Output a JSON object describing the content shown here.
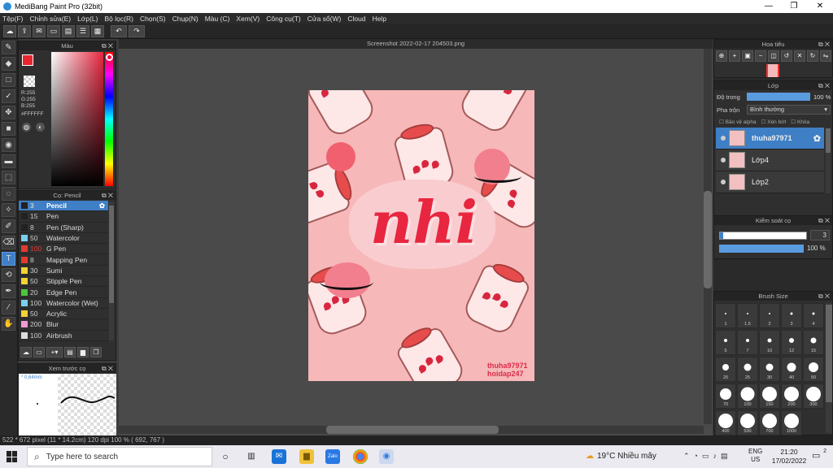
{
  "window": {
    "title": "MediBang Paint Pro (32bit)",
    "minimize": "—",
    "maximize": "❐",
    "close": "✕"
  },
  "menu": [
    "Tệp(F)",
    "Chỉnh sửa(E)",
    "Lớp(L)",
    "Bộ lọc(R)",
    "Chọn(S)",
    "Chụp(N)",
    "Màu (C)",
    "Xem(V)",
    "Công cụ(T)",
    "Cửa sổ(W)",
    "Cloud",
    "Help"
  ],
  "toolbar": {
    "undo": "↶",
    "redo": "↷"
  },
  "color_panel": {
    "title": "Màu",
    "r": "R:255",
    "g": "G:255",
    "b": "B:255",
    "hex": "#FFFFFF",
    "fg_color": "#e8262f",
    "bg_color": "#ffffff"
  },
  "brush_panel": {
    "title": "Cọ: Pencil",
    "brushes": [
      {
        "size": "3",
        "name": "Pencil",
        "color": "#222222",
        "selected": true
      },
      {
        "size": "15",
        "name": "Pen",
        "color": "#222222"
      },
      {
        "size": "8",
        "name": "Pen (Sharp)",
        "color": "#222222"
      },
      {
        "size": "50",
        "name": "Watercolor",
        "color": "#7ad0f0"
      },
      {
        "size": "100",
        "name": "G Pen",
        "color": "#e33a2f",
        "red": true
      },
      {
        "size": "8",
        "name": "Mapping Pen",
        "color": "#e33a2f"
      },
      {
        "size": "30",
        "name": "Sumi",
        "color": "#f3d233"
      },
      {
        "size": "50",
        "name": "Stipple Pen",
        "color": "#f3d233"
      },
      {
        "size": "20",
        "name": "Edge Pen",
        "color": "#4bc53b"
      },
      {
        "size": "100",
        "name": "Watercolor (Wet)",
        "color": "#7ad0f0"
      },
      {
        "size": "50",
        "name": "Acrylic",
        "color": "#f3d233"
      },
      {
        "size": "200",
        "name": "Blur",
        "color": "#f09ad6"
      },
      {
        "size": "100",
        "name": "Airbrush",
        "color": "#dddddd"
      }
    ]
  },
  "preview_panel": {
    "title": "Xem trước cọ",
    "size": "* 0,64mm"
  },
  "document": {
    "tab": "Screenshot 2022-02-17 204503.png",
    "title_text": "nhi",
    "watermark1": "thuha97971",
    "watermark2": "hoidap247"
  },
  "navigator": {
    "title": "Hoa tiêu"
  },
  "layer_panel": {
    "title": "Lớp",
    "opacity_label": "Độ trong",
    "opacity_value": "100 %",
    "opacity": 1.0,
    "blend_label": "Pha trộn",
    "blend_value": "Bình thường",
    "protect_alpha": "Bảo vệ alpha",
    "clip": "Xén bớt",
    "lock": "Khóa",
    "layers": [
      {
        "name": "thuha97971",
        "selected": true
      },
      {
        "name": "Lớp4"
      },
      {
        "name": "Lớp2"
      }
    ]
  },
  "brush_control": {
    "title": "Kiểm soát cọ",
    "size": "3",
    "opacity": "100 %",
    "size_fraction": 0.01,
    "opacity_fraction": 1.0
  },
  "brush_size_panel": {
    "title": "Brush Size",
    "sizes": [
      "1",
      "1.5",
      "2",
      "3",
      "4",
      "5",
      "7",
      "10",
      "12",
      "15",
      "20",
      "25",
      "30",
      "40",
      "50",
      "70",
      "100",
      "150",
      "200",
      "300",
      "400",
      "500",
      "700",
      "1000"
    ]
  },
  "status": "522 * 672 pixel   (11 * 14.2cm)   120 dpi   100 %   ( 692, 767 )",
  "taskbar": {
    "search_placeholder": "Type here to search",
    "weather": "19°C  Nhiều mây",
    "lang1": "ENG",
    "lang2": "US",
    "time": "21:20",
    "date": "17/02/2022",
    "notif": "2"
  }
}
